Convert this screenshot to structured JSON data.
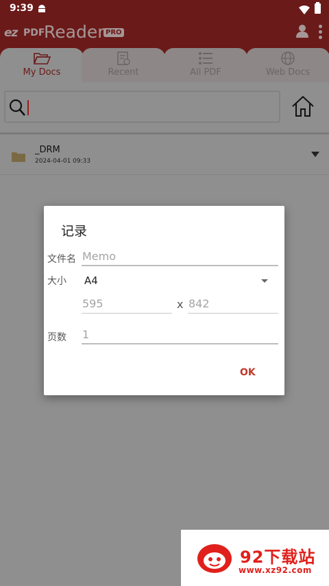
{
  "status_bar": {
    "time": "9:39"
  },
  "app_bar": {
    "logo_ez": "ez",
    "logo_pdf": "PDF",
    "logo_reader": "Reader",
    "logo_pro": "PRO"
  },
  "tabs": [
    {
      "label": "My Docs",
      "icon": "folder-open-icon",
      "active": true
    },
    {
      "label": "Recent",
      "icon": "recent-doc-icon",
      "active": false
    },
    {
      "label": "All PDF",
      "icon": "list-icon",
      "active": false
    },
    {
      "label": "Web Docs",
      "icon": "globe-icon",
      "active": false
    }
  ],
  "search": {
    "value": "",
    "placeholder": ""
  },
  "files": [
    {
      "name": "_DRM",
      "date": "2024-04-01 09:33"
    }
  ],
  "dialog": {
    "title": "记录",
    "filename_label": "文件名",
    "filename_placeholder": "Memo",
    "size_label": "大小",
    "size_value": "A4",
    "width_placeholder": "595",
    "separator": "x",
    "height_placeholder": "842",
    "pages_label": "页数",
    "pages_placeholder": "1",
    "ok_label": "OK"
  },
  "watermark": {
    "text": "92下载站",
    "url": "www.xz92.com"
  },
  "colors": {
    "accent": "#6a1a19",
    "ok_button": "#c0392b",
    "watermark": "#e0201c"
  }
}
